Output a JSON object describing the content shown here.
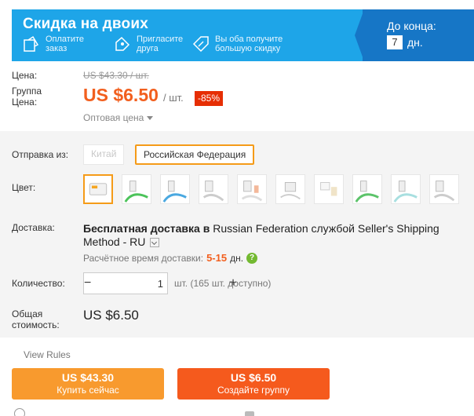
{
  "banner": {
    "title": "Скидка на двоих",
    "steps": [
      {
        "icon": "pay-icon",
        "text1": "Оплатите",
        "text2": "заказ"
      },
      {
        "icon": "invite-icon",
        "text1": "Пригласите",
        "text2": "друга"
      },
      {
        "icon": "discount-tag-icon",
        "text1": "Вы оба получите",
        "text2": "большую скидку"
      }
    ],
    "deadline_label": "До конца:",
    "deadline_value": "7",
    "deadline_unit": "дн."
  },
  "price": {
    "label": "Цена:",
    "old": "US $43.30 / шт.",
    "group_label": "Группа Цена:",
    "current": "US $6.50",
    "unit": "/ шт.",
    "discount": "-85%",
    "wholesale": "Оптовая цена"
  },
  "shipping_from": {
    "label": "Отправка из:",
    "options": [
      "Китай",
      "Российская Федерация"
    ],
    "selected": "Российская Федерация"
  },
  "color": {
    "label": "Цвет:",
    "swatch_count": 10,
    "selected_index": 0
  },
  "delivery": {
    "label": "Доставка:",
    "lead": "Бесплатная доставка в",
    "rest": "Russian Federation службой Seller's Shipping Method - RU",
    "est_label": "Расчётное время доставки:",
    "est_days": "5-15",
    "est_unit": "дн.",
    "help": "?"
  },
  "quantity": {
    "label": "Количество:",
    "value": "1",
    "minus": "−",
    "plus": "+",
    "available": "шт. (165 шт. доступно)"
  },
  "total": {
    "label": "Общая стоимость:",
    "value": "US $6.50"
  },
  "rules_link": "View Rules",
  "buttons": {
    "buy": {
      "price": "US $43.30",
      "label": "Купить сейчас"
    },
    "group": {
      "price": "US $6.50",
      "label": "Создайте группу"
    }
  },
  "colors": {
    "accent_orange": "#f25f1e",
    "banner_blue": "#1ea5e8",
    "banner_dark": "#1676c6",
    "selected_border": "#f59b18"
  }
}
